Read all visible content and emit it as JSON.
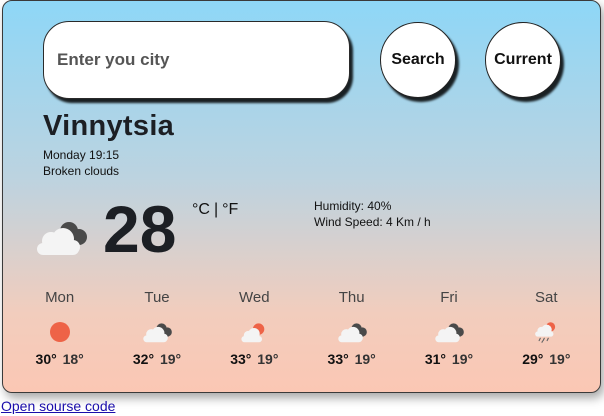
{
  "search": {
    "placeholder": "Enter you city",
    "value": ""
  },
  "buttons": {
    "search": "Search",
    "current": "Current"
  },
  "current": {
    "city": "Vinnytsia",
    "date": "Monday 19:15",
    "description": "Broken clouds",
    "icon": "broken-clouds-icon",
    "temperature": "28",
    "unit_c": "°C",
    "unit_sep": "|",
    "unit_f": "°F",
    "humidity": "Humidity: 40%",
    "wind": "Wind Speed: 4 Km / h"
  },
  "forecast": [
    {
      "day": "Mon",
      "icon": "sun-icon",
      "max": "30°",
      "min": "18°"
    },
    {
      "day": "Tue",
      "icon": "broken-clouds-icon",
      "max": "32°",
      "min": "19°"
    },
    {
      "day": "Wed",
      "icon": "sun-behind-cloud-icon",
      "max": "33°",
      "min": "19°"
    },
    {
      "day": "Thu",
      "icon": "broken-clouds-icon",
      "max": "33°",
      "min": "19°"
    },
    {
      "day": "Fri",
      "icon": "broken-clouds-icon",
      "max": "31°",
      "min": "19°"
    },
    {
      "day": "Sat",
      "icon": "rain-cloud-icon",
      "max": "29°",
      "min": "19°"
    }
  ],
  "footer": {
    "link": "Open sourse code"
  },
  "colors": {
    "sun": "#ee6347",
    "dark_cloud": "#4a4a4a",
    "light_cloud": "#f2f2f2",
    "link": "#1a0dab"
  }
}
